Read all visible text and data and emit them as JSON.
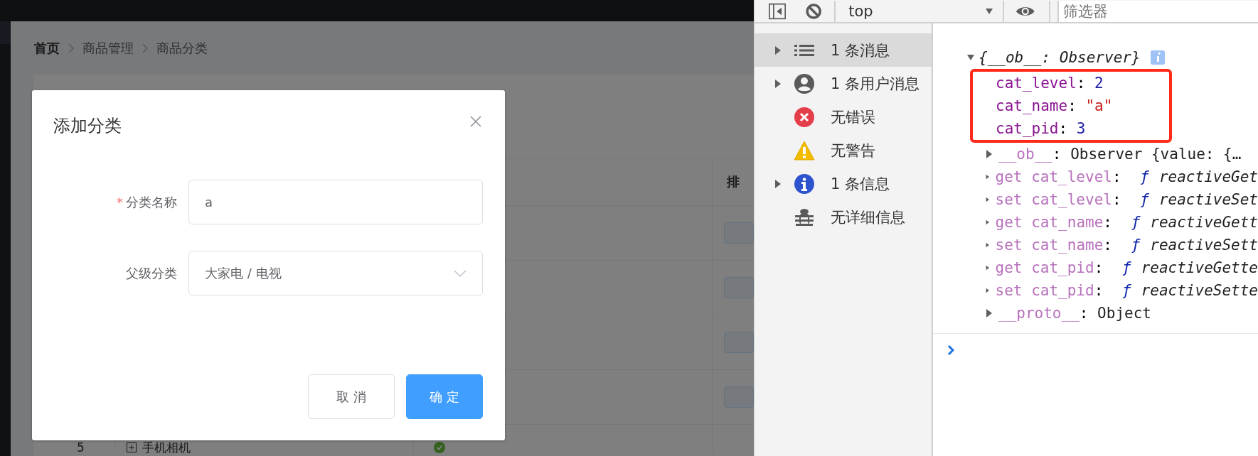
{
  "app": {
    "breadcrumb": [
      {
        "label": "首页",
        "kind": "home"
      },
      {
        "label": "商品管理",
        "kind": "link"
      },
      {
        "label": "商品分类",
        "kind": "link"
      }
    ],
    "table": {
      "column_4": "排",
      "row": {
        "index": "5",
        "name": "手机相机",
        "expandable": true,
        "valid": true
      }
    },
    "dialog": {
      "title": "添加分类",
      "fields": [
        {
          "label": "分类名称",
          "required_mark": "*",
          "kind": "text",
          "value": "a"
        },
        {
          "label": "父级分类",
          "kind": "select",
          "value": "大家电 / 电视"
        }
      ],
      "buttons": [
        {
          "label": "取 消",
          "kind": "default"
        },
        {
          "label": "确 定",
          "kind": "primary"
        }
      ]
    }
  },
  "devtools": {
    "toolbar": {
      "context": "top",
      "filter_placeholder": "筛选器"
    },
    "sidebar": [
      {
        "label": "1 条消息",
        "kind": "list",
        "expandable": true,
        "selected": true
      },
      {
        "label": "1 条用户消息",
        "kind": "user",
        "expandable": true,
        "selected": false
      },
      {
        "label": "无错误",
        "kind": "error",
        "expandable": false,
        "selected": false
      },
      {
        "label": "无警告",
        "kind": "warning",
        "expandable": false,
        "selected": false
      },
      {
        "label": "1 条信息",
        "kind": "info",
        "expandable": true,
        "selected": false
      },
      {
        "label": "无详细信息",
        "kind": "verbose",
        "expandable": false,
        "selected": false
      }
    ],
    "console": {
      "object": {
        "summary": "{__ob__: Observer}",
        "expanded": true,
        "highlighted": [
          {
            "key": "cat_level",
            "separator": ":",
            "value": "2",
            "kind": "number"
          },
          {
            "key": "cat_name",
            "separator": ":",
            "value": "\"a\"",
            "kind": "string"
          },
          {
            "key": "cat_pid",
            "separator": ":",
            "value": "3",
            "kind": "number"
          }
        ],
        "children": [
          {
            "key": "__ob__",
            "separator": ":",
            "value": "Observer {value: {…",
            "kind": "own"
          },
          {
            "key": "get cat_level",
            "separator": ":",
            "function_mark": "ƒ",
            "value": "reactiveGet",
            "kind": "accessor"
          },
          {
            "key": "set cat_level",
            "separator": ":",
            "function_mark": "ƒ",
            "value": "reactiveSet",
            "kind": "accessor"
          },
          {
            "key": "get cat_name",
            "separator": ":",
            "function_mark": "ƒ",
            "value": "reactiveGett",
            "kind": "accessor"
          },
          {
            "key": "set cat_name",
            "separator": ":",
            "function_mark": "ƒ",
            "value": "reactiveSett",
            "kind": "accessor"
          },
          {
            "key": "get cat_pid",
            "separator": ":",
            "function_mark": "ƒ",
            "value": "reactiveGette",
            "kind": "accessor"
          },
          {
            "key": "set cat_pid",
            "separator": ":",
            "function_mark": "ƒ",
            "value": "reactiveSette",
            "kind": "accessor"
          },
          {
            "key": "__proto__",
            "separator": ":",
            "value": "Object",
            "kind": "own"
          }
        ]
      }
    }
  }
}
